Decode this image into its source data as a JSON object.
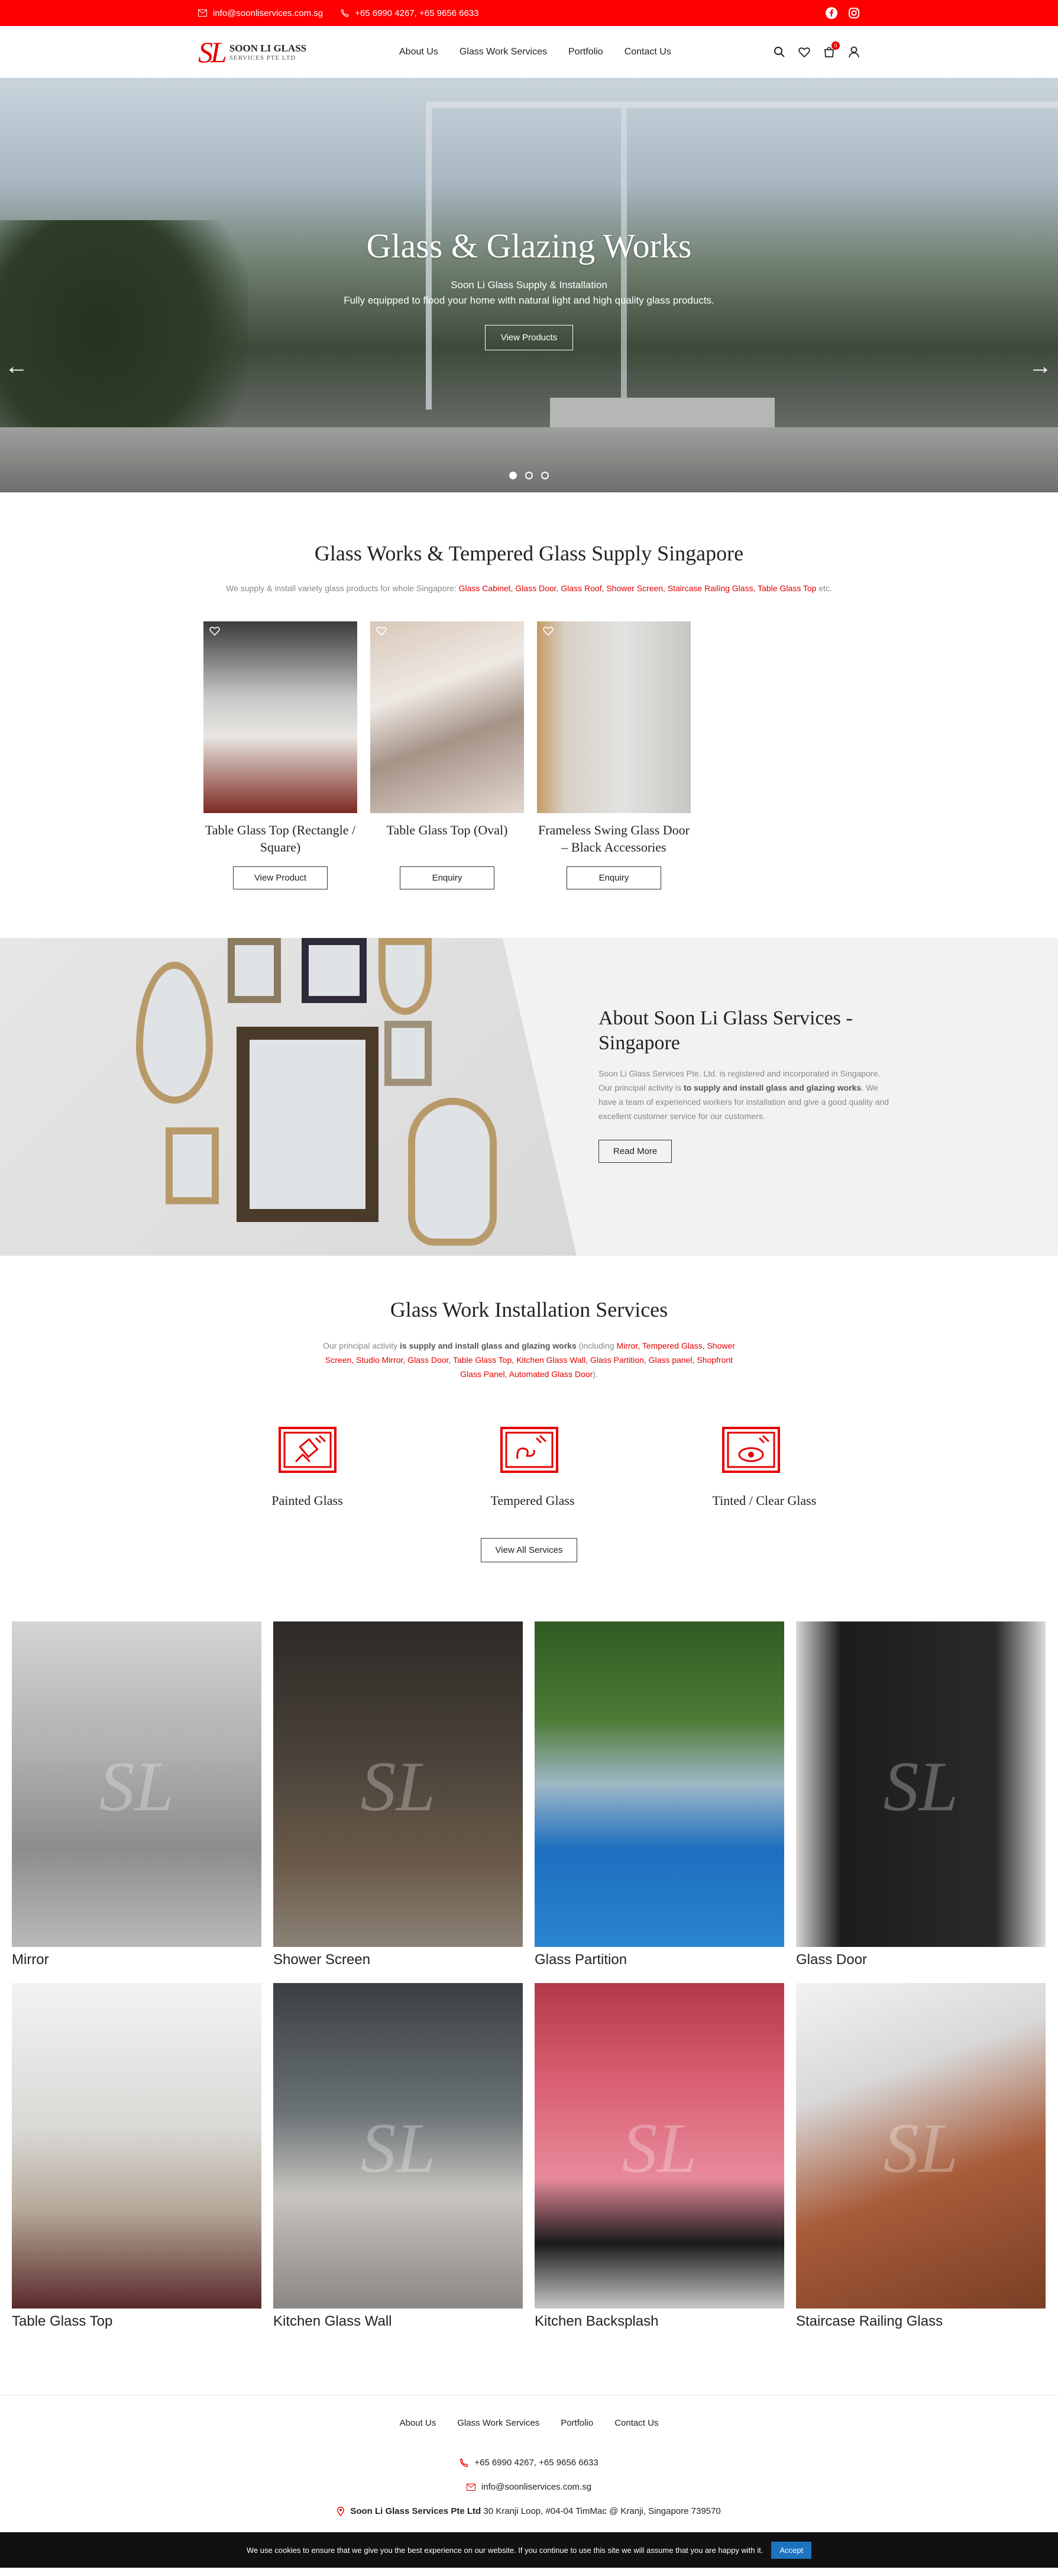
{
  "topbar": {
    "email": "info@soonliservices.com.sg",
    "phone": "+65 6990 4267, +65 9656 6633"
  },
  "header": {
    "logo_mark": "SL",
    "logo_line1": "SOON LI GLASS",
    "logo_line2": "SERVICES PTE LTD",
    "nav": [
      "About Us",
      "Glass Work Services",
      "Portfolio",
      "Contact Us"
    ],
    "cart_count": "0"
  },
  "hero": {
    "title": "Glass & Glazing Works",
    "line1": "Soon Li Glass Supply & Installation",
    "line2": "Fully equipped to flood your home with natural light and high quality glass products.",
    "button": "View Products",
    "prev": "←",
    "next": "→"
  },
  "supply": {
    "title": "Glass Works & Tempered Glass Supply Singapore",
    "desc_prefix": "We supply & install variety glass products for whole Singapore: ",
    "links": "Glass Cabinet, Glass Door, Glass Roof, Shower Screen, Staircase Railing Glass, Table Glass Top",
    "desc_suffix": " etc.",
    "products": [
      {
        "name": "Table Glass Top (Rectangle / Square)",
        "button": "View Product"
      },
      {
        "name": "Table Glass Top (Oval)",
        "button": "Enquiry"
      },
      {
        "name": "Frameless Swing Glass Door – Black Accessories",
        "button": "Enquiry"
      }
    ]
  },
  "about": {
    "title": "About Soon Li Glass Services - Singapore",
    "p1": "Soon Li Glass Services Pte. Ltd. is registered and incorporated in Singapore. Our principal activity is ",
    "p1_bold": "to supply and install glass and glazing works",
    "p1_end": ". We have a team of experienced workers for installation and give a good quality and excellent customer service for our customers.",
    "button": "Read More"
  },
  "services": {
    "title": "Glass Work Installation Services",
    "desc_prefix": "Our principal activity ",
    "desc_bold": "is supply and install glass and glazing works",
    "desc_mid": " (including ",
    "desc_links": "Mirror, Tempered Glass, Shower Screen, Studio Mirror, Glass Door, Table Glass Top, Kitchen Glass Wall, Glass Partition, Glass panel, Shopfront Glass Panel, Automated Glass Door",
    "desc_suffix": ").",
    "items": [
      "Painted Glass",
      "Tempered Glass",
      "Tinted / Clear Glass"
    ],
    "button": "View All Services"
  },
  "gallery": {
    "watermark": "SL",
    "items": [
      "Mirror",
      "Shower Screen",
      "Glass Partition",
      "Glass Door",
      "Table Glass Top",
      "Kitchen Glass Wall",
      "Kitchen Backsplash",
      "Staircase Railing Glass"
    ]
  },
  "footer": {
    "nav": [
      "About Us",
      "Glass Work Services",
      "Portfolio",
      "Contact Us"
    ],
    "phone": "+65 6990 4267, +65 9656 6633",
    "email": "info@soonliservices.com.sg",
    "company": "Soon Li Glass Services Pte Ltd",
    "address": " 30 Kranji Loop, #04-04 TimMac @ Kranji, Singapore 739570"
  },
  "cookie": {
    "text": "We use cookies to ensure that we give you the best experience on our website. If you continue to use this site we will assume that you are happy with it.",
    "accept": "Accept"
  },
  "colors": {
    "brand_red": "#ff0000",
    "accent": "#e60000",
    "accept_blue": "#1e73be"
  }
}
